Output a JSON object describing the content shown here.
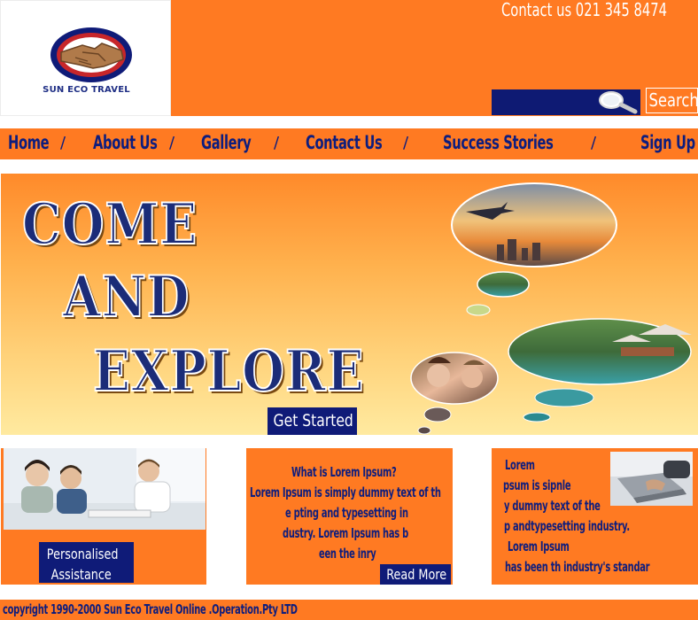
{
  "brand": {
    "name": "SUN ECO TRAVEL",
    "logo_icon": "handshake-globe-icon",
    "colors": {
      "orange": "#ff7a22",
      "navy": "#0f1b78",
      "text_navy": "#0d1d7e"
    }
  },
  "header": {
    "contact": "Contact us 021 345 8474",
    "search_placeholder": "",
    "search_icon": "search-icon",
    "search_label": "Search"
  },
  "nav": {
    "items": [
      "Home",
      "About Us",
      "Gallery",
      "Contact Us",
      "Success Stories",
      "Sign Up"
    ],
    "separator": "/"
  },
  "hero": {
    "line1": "COME",
    "line2": "AND",
    "line3": "EXPLORE",
    "cta": "Get Started",
    "bubble_images": [
      "airplane-over-city-sunset-photo",
      "friends-laughing-photo",
      "resort-pool-photo"
    ]
  },
  "cards": {
    "one": {
      "image": "office-meeting-photo",
      "button": [
        "Personalised",
        "Assistance"
      ]
    },
    "two": {
      "lines": [
        "What is Lorem Ipsum?",
        "Lorem Ipsum is simply dummy text of th",
        "e pting and typesetting in",
        "dustry. Lorem Ipsum has b",
        "een the inry"
      ],
      "button": "Read More"
    },
    "three": {
      "image": "laptop-typing-photo",
      "lines": [
        "Lorem",
        "psum is sipnle",
        "y dummy text of the",
        "p  andtypesetting industry.",
        "Lorem Ipsum",
        "has been th     industry's standar"
      ]
    }
  },
  "footer": {
    "copyright": "copyright 1990-2000 Sun Eco Travel Online .Operation.Pty LTD"
  }
}
